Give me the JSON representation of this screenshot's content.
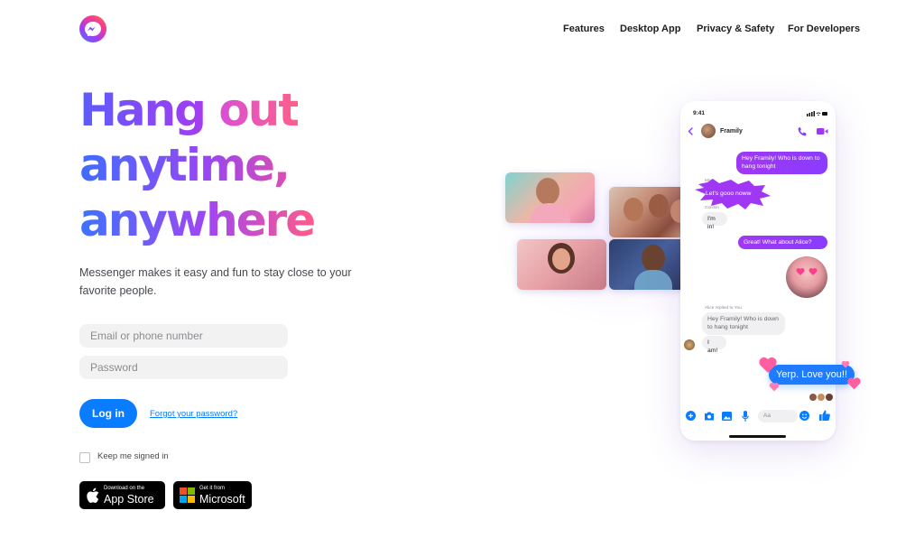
{
  "nav": {
    "features": "Features",
    "desktop_app": "Desktop App",
    "privacy_safety": "Privacy & Safety",
    "for_developers": "For Developers"
  },
  "hero": {
    "line1_a": "Hang",
    "line1_b": "out",
    "line2": "anytime,",
    "line3": "anywhere"
  },
  "subtitle": "Messenger makes it easy and fun to stay close to your favorite people.",
  "form": {
    "email_placeholder": "Email or phone number",
    "password_placeholder": "Password",
    "login_label": "Log in",
    "forgot_label": "Forgot your password?",
    "keep_signed_in": "Keep me signed in"
  },
  "stores": {
    "apple_small": "Download on the",
    "apple_big": "App Store",
    "ms_small": "Get it from",
    "ms_big": "Microsoft"
  },
  "phone": {
    "time": "9:41",
    "chat_name": "Framily",
    "msg1": "Hey Framily! Who is down to hang tonight",
    "sender1": "Meg",
    "msg2": "Let's gooo noww",
    "sender2": "Gordon",
    "msg3": "I'm in!",
    "msg4": "Great! What about Alice?",
    "reply_context": "Alice replied to You",
    "msg5": "Hey Framily! Who is down to hang tonight",
    "msg6": "I am!",
    "msg7": "Yerp. Love you!!",
    "composer_placeholder": "Aa"
  },
  "colors": {
    "accent_blue": "#0a7cff",
    "bubble_purple": "#a037f5",
    "pink": "#ff4f9a"
  },
  "icons": [
    "messenger-logo-icon",
    "apple-icon",
    "microsoft-icon",
    "back-icon",
    "phone-call-icon",
    "video-call-icon",
    "plus-icon",
    "camera-icon",
    "image-icon",
    "mic-icon",
    "emoji-icon",
    "thumbs-up-icon"
  ]
}
